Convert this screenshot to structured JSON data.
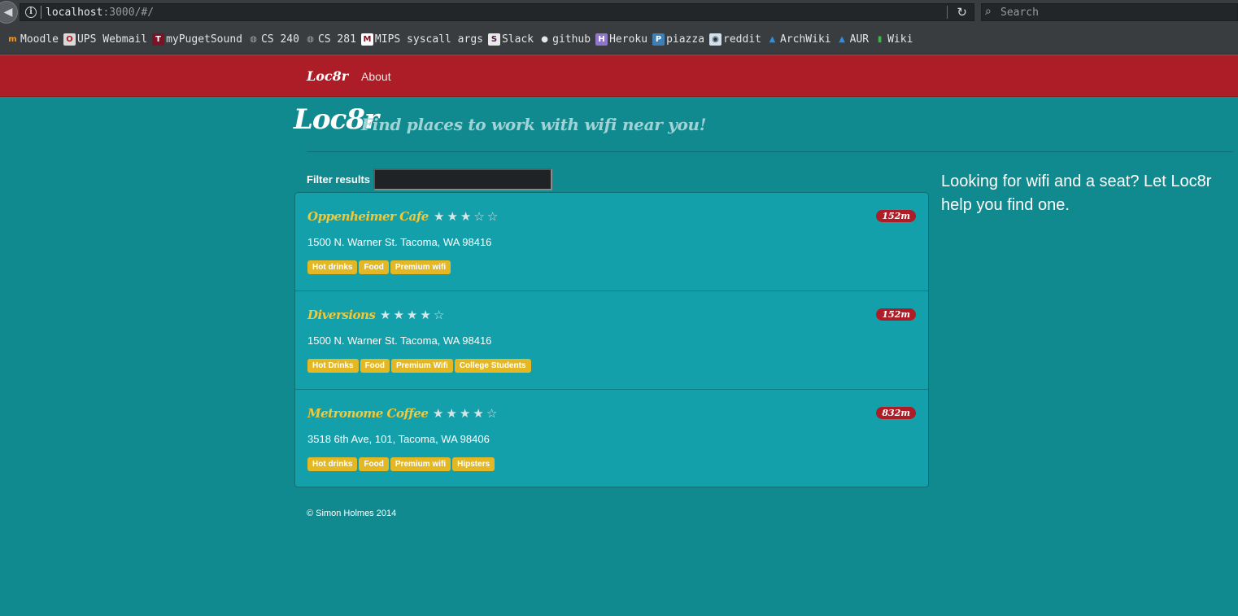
{
  "browser": {
    "url_host": "localhost",
    "url_rest": ":3000/#/",
    "search_placeholder": "Search"
  },
  "bookmarks": [
    {
      "label": "Moodle",
      "icon": "moodle-icon",
      "glyph": "m",
      "bg": "#3a3d40",
      "fg": "#f59a23"
    },
    {
      "label": "UPS Webmail",
      "icon": "outlook-icon",
      "glyph": "O",
      "bg": "#d9d9d9",
      "fg": "#b0191e"
    },
    {
      "label": "myPugetSound",
      "icon": "puget-sound-icon",
      "glyph": "T",
      "bg": "#7a1425",
      "fg": "#ffffff"
    },
    {
      "label": "CS 240",
      "icon": "globe-icon",
      "glyph": "◍",
      "bg": "#3a3d40",
      "fg": "#a8a8a8"
    },
    {
      "label": "CS 281",
      "icon": "globe-icon",
      "glyph": "◍",
      "bg": "#3a3d40",
      "fg": "#a8a8a8"
    },
    {
      "label": "MIPS syscall args",
      "icon": "mips-icon",
      "glyph": "M",
      "bg": "#ffffff",
      "fg": "#7a1425"
    },
    {
      "label": "Slack",
      "icon": "slack-icon",
      "glyph": "S",
      "bg": "#e9e9e9",
      "fg": "#4a154b"
    },
    {
      "label": "github",
      "icon": "github-icon",
      "glyph": "●",
      "bg": "#3a3d40",
      "fg": "#e6e6e6"
    },
    {
      "label": "Heroku",
      "icon": "heroku-icon",
      "glyph": "H",
      "bg": "#8f76c9",
      "fg": "#ffffff"
    },
    {
      "label": "piazza",
      "icon": "piazza-icon",
      "glyph": "P",
      "bg": "#3e7fb6",
      "fg": "#ffffff"
    },
    {
      "label": "reddit",
      "icon": "reddit-icon",
      "glyph": "◉",
      "bg": "#cfe0f1",
      "fg": "#333333"
    },
    {
      "label": "ArchWiki",
      "icon": "arch-icon",
      "glyph": "▲",
      "bg": "#3a3d40",
      "fg": "#2d8fde"
    },
    {
      "label": "AUR",
      "icon": "arch-icon",
      "glyph": "▲",
      "bg": "#3a3d40",
      "fg": "#2d8fde"
    },
    {
      "label": "Wiki",
      "icon": "wiki-icon",
      "glyph": "▮",
      "bg": "#3a3d40",
      "fg": "#3cb44a"
    }
  ],
  "navbar": {
    "brand": "Loc8r",
    "about": "About"
  },
  "header": {
    "title": "Loc8r",
    "tagline": "Find places to work with wifi near you!"
  },
  "filter": {
    "label": "Filter results",
    "value": ""
  },
  "locations": [
    {
      "name": "Oppenheimer Cafe",
      "rating": 3,
      "distance": "152m",
      "address": "1500 N. Warner St. Tacoma, WA 98416",
      "facilities": [
        "Hot drinks",
        "Food",
        "Premium wifi"
      ]
    },
    {
      "name": "Diversions",
      "rating": 4,
      "distance": "152m",
      "address": "1500 N. Warner St. Tacoma, WA 98416",
      "facilities": [
        "Hot Drinks",
        "Food",
        "Premium Wifi",
        "College Students"
      ]
    },
    {
      "name": "Metronome Coffee",
      "rating": 4,
      "distance": "832m",
      "address": "3518 6th Ave, 101, Tacoma, WA 98406",
      "facilities": [
        "Hot drinks",
        "Food",
        "Premium wifi",
        "Hipsters"
      ]
    }
  ],
  "sidebar": {
    "text": "Looking for wifi and a seat? Let Loc8r help you find one."
  },
  "footer": {
    "text": "© Simon Holmes 2014"
  },
  "colors": {
    "navbar": "#ac1d27",
    "background": "#118a8f",
    "card": "#14a0aa",
    "name": "#f0c93a",
    "tag": "#e3b824"
  }
}
